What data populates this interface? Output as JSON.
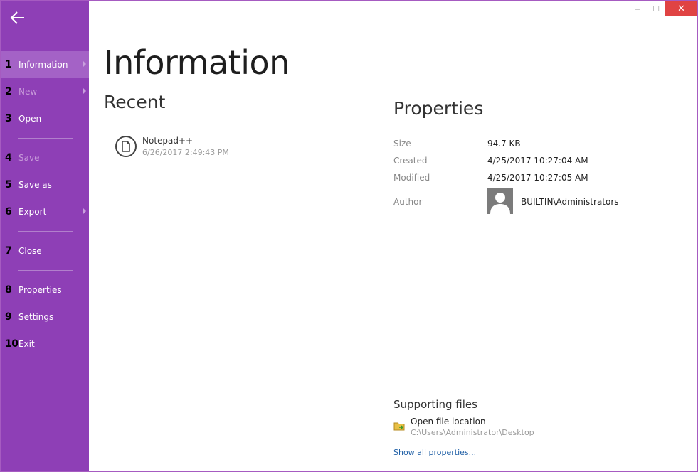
{
  "sidebar": {
    "items": [
      {
        "num": "1",
        "label": "Information",
        "active": true,
        "disabled": false,
        "submenu": true
      },
      {
        "num": "2",
        "label": "New",
        "active": false,
        "disabled": true,
        "submenu": true
      },
      {
        "num": "3",
        "label": "Open",
        "active": false,
        "disabled": false,
        "submenu": false
      },
      {
        "num": "4",
        "label": "Save",
        "active": false,
        "disabled": true,
        "submenu": false
      },
      {
        "num": "5",
        "label": "Save as",
        "active": false,
        "disabled": false,
        "submenu": false
      },
      {
        "num": "6",
        "label": "Export",
        "active": false,
        "disabled": false,
        "submenu": true
      },
      {
        "num": "7",
        "label": "Close",
        "active": false,
        "disabled": false,
        "submenu": false
      },
      {
        "num": "8",
        "label": "Properties",
        "active": false,
        "disabled": false,
        "submenu": false
      },
      {
        "num": "9",
        "label": "Settings",
        "active": false,
        "disabled": false,
        "submenu": false
      },
      {
        "num": "10",
        "label": "Exit",
        "active": false,
        "disabled": false,
        "submenu": false
      }
    ]
  },
  "window": {
    "minimize": "‒",
    "maximize": "☐",
    "close": "✕"
  },
  "main": {
    "title": "Information",
    "recent": {
      "heading": "Recent",
      "items": [
        {
          "name": "Notepad++",
          "date": "6/26/2017 2:49:43 PM"
        }
      ]
    },
    "properties": {
      "heading": "Properties",
      "size_label": "Size",
      "size_value": "94.7 KB",
      "created_label": "Created",
      "created_value": "4/25/2017 10:27:04 AM",
      "modified_label": "Modified",
      "modified_value": "4/25/2017 10:27:05 AM",
      "author_label": "Author",
      "author_value": "BUILTIN\\Administrators"
    },
    "supporting": {
      "heading": "Supporting files",
      "open_location": "Open file location",
      "location_path": "C:\\Users\\Administrator\\Desktop",
      "show_all": "Show all properties..."
    }
  },
  "colors": {
    "sidebar_bg": "#8e3fb6",
    "active_item_bg": "#a462c6",
    "close_button": "#e04343",
    "link": "#1f5fa6"
  }
}
